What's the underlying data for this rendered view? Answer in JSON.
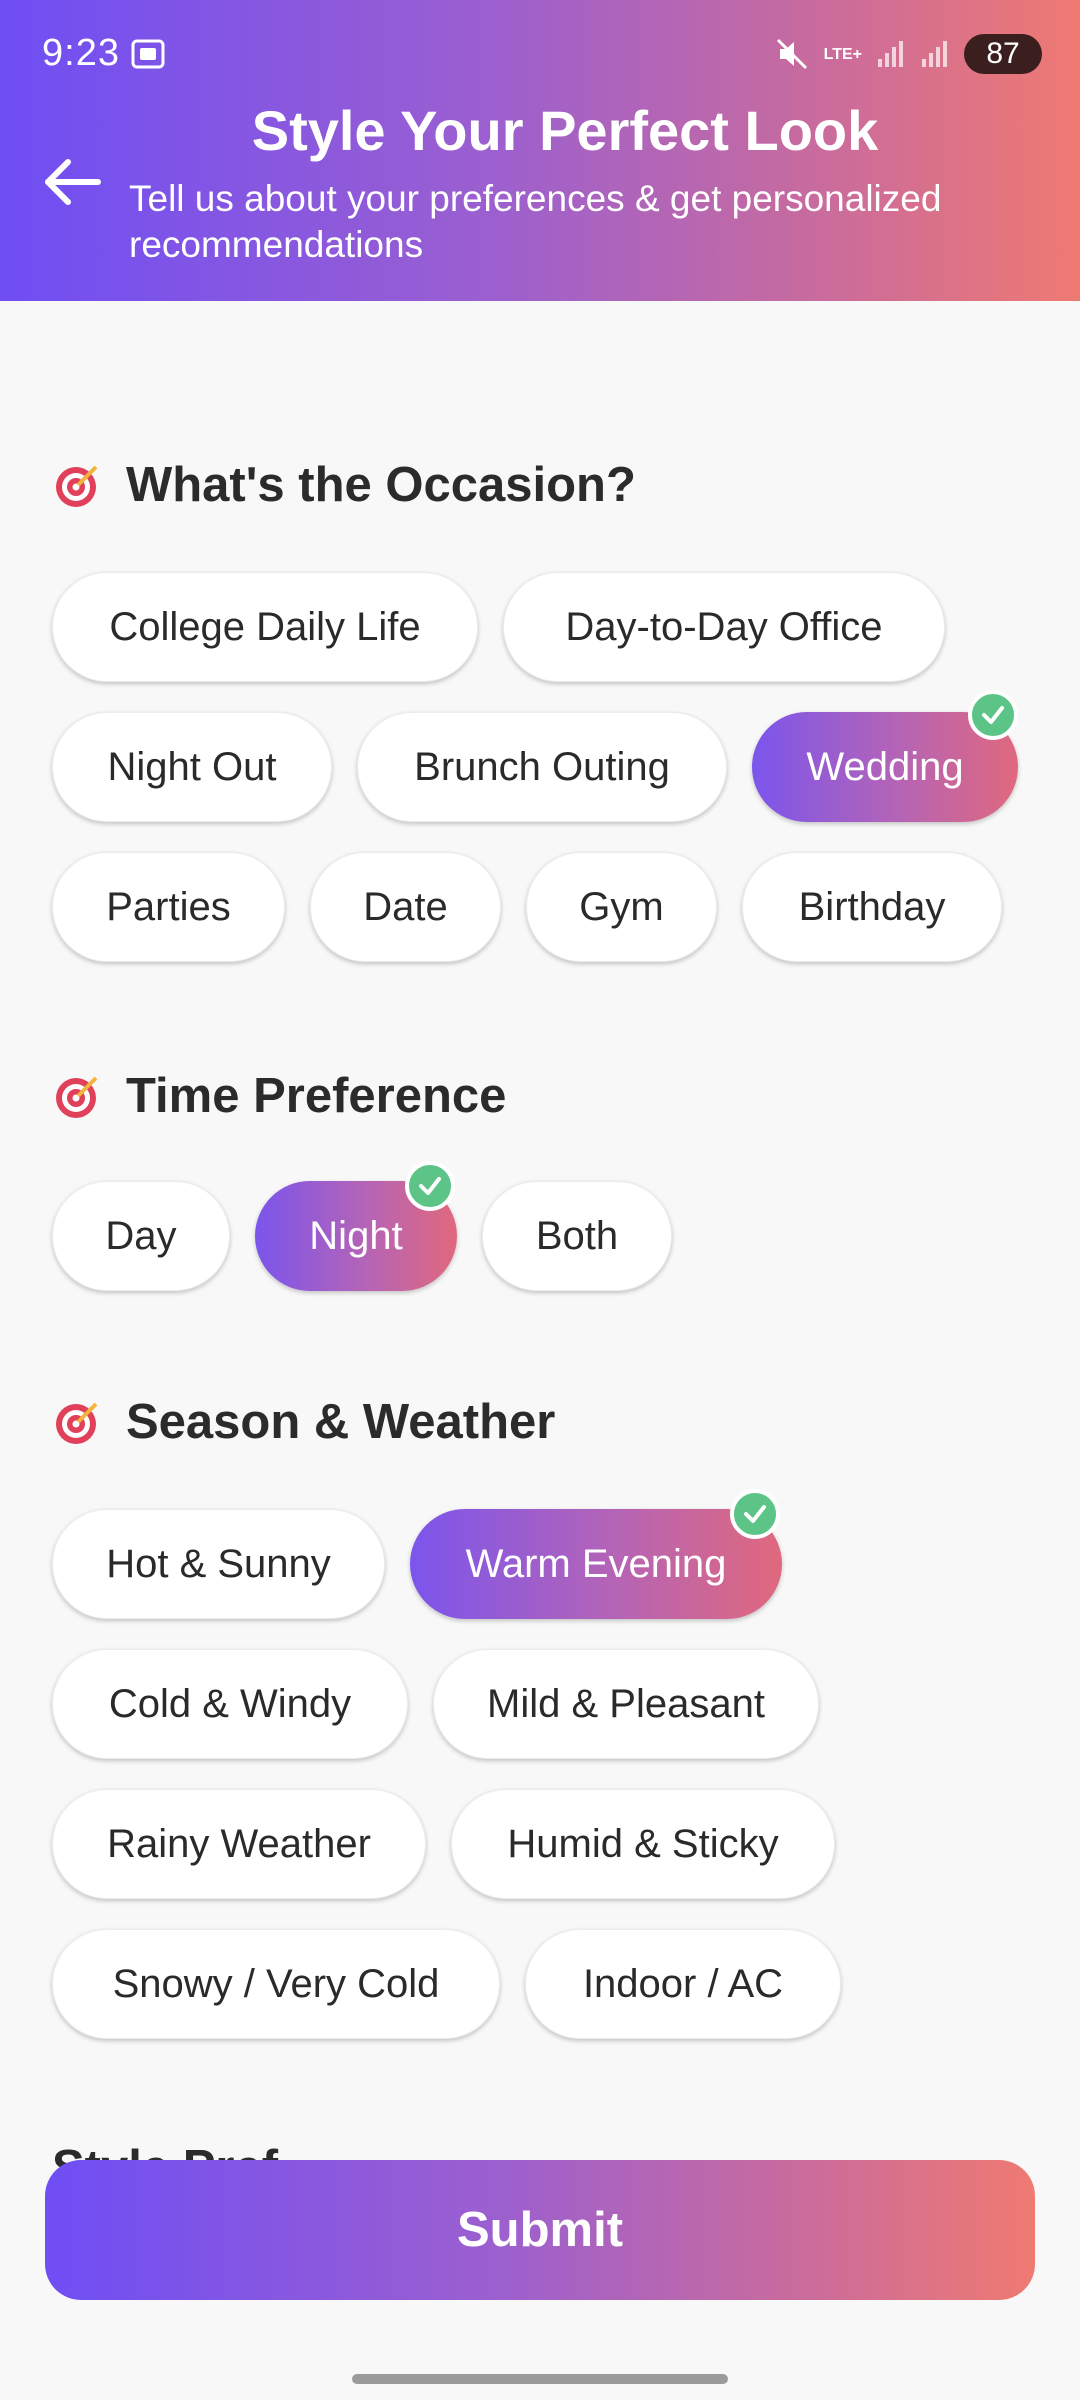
{
  "status_bar": {
    "time": "9:23",
    "network": "LTE+",
    "battery": "87"
  },
  "header": {
    "title": "Style Your Perfect Look",
    "subtitle": "Tell us about your preferences & get personalized recommendations"
  },
  "sections": {
    "occasion": {
      "title": "What's the Occasion?",
      "options": [
        "College Daily Life",
        "Day-to-Day Office",
        "Night Out",
        "Brunch Outing",
        "Wedding",
        "Parties",
        "Date",
        "Gym",
        "Birthday"
      ],
      "selected": "Wedding"
    },
    "time": {
      "title": "Time Preference",
      "options": [
        "Day",
        "Night",
        "Both"
      ],
      "selected": "Night"
    },
    "season": {
      "title": "Season & Weather",
      "options": [
        "Hot & Sunny",
        "Warm Evening",
        "Cold & Windy",
        "Mild & Pleasant",
        "Rainy Weather",
        "Humid & Sticky",
        "Snowy / Very Cold",
        "Indoor / AC"
      ],
      "selected": "Warm Evening"
    },
    "next_partial": {
      "title": "Style Pref"
    }
  },
  "submit_label": "Submit",
  "colors": {
    "gradient_start": "#6f4ef4",
    "gradient_end": "#ef7a72",
    "check_green": "#5cc486"
  },
  "icons": {
    "back": "arrow-left-icon",
    "section": "target-icon",
    "check": "check-circle-icon"
  }
}
